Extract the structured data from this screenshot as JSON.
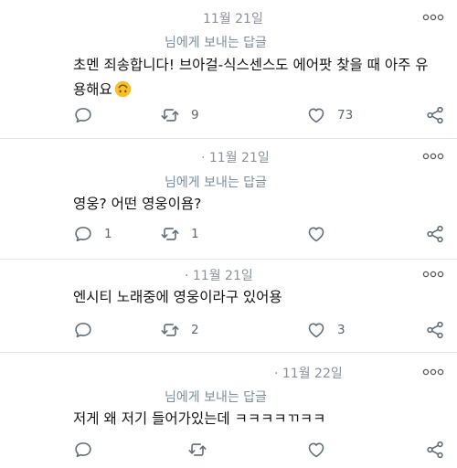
{
  "tweets": [
    {
      "date": "11월 21일",
      "replying": "님에게 보내는 답글",
      "text": "초멘 죄송합니다! 브아걸-식스센스도 에어팟 찾을 때 아주 유용해요",
      "emoji": "upside-down-face",
      "replies": "",
      "retweets": "9",
      "likes": "73"
    },
    {
      "date": "· 11월 21일",
      "replying": "님에게 보내는 답글",
      "text": "영웅? 어떤 영웅이욤?",
      "replies": "1",
      "retweets": "1",
      "likes": ""
    },
    {
      "date": "· 11월 21일",
      "replying": "",
      "text": "엔시티 노래중에 영웅이라구 있어용",
      "replies": "",
      "retweets": "2",
      "likes": "3"
    },
    {
      "date": "· 11월 22일",
      "replying": "님에게 보내는 답글",
      "text": "저게 왜 저기 들어가있는데 ㅋㅋㅋㅋㄲㅋㅋ",
      "replies": "",
      "retweets": "",
      "likes": ""
    }
  ],
  "colors": {
    "text": "#111111",
    "muted": "#8a9199",
    "link": "#7a8d9c",
    "divider": "#e3e3e3",
    "emoji_fill": "#f7c02b"
  }
}
